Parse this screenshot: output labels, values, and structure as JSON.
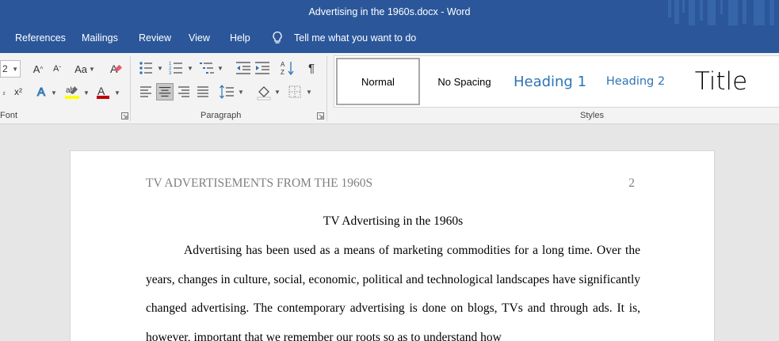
{
  "window": {
    "title": "Advertising in the 1960s.docx  -  Word"
  },
  "menu": {
    "tabs": [
      "References",
      "Mailings",
      "Review",
      "View",
      "Help"
    ],
    "tell_me": "Tell me what you want to do"
  },
  "ribbon": {
    "font_size": "2",
    "font_group_label": "Font",
    "paragraph_group_label": "Paragraph",
    "styles_group_label": "Styles",
    "pilcrow": "¶",
    "styles": [
      {
        "label": "Normal",
        "active": true
      },
      {
        "label": "No Spacing",
        "active": false
      },
      {
        "label": "Heading 1",
        "active": false
      },
      {
        "label": "Heading 2",
        "active": false
      },
      {
        "label": "Title",
        "active": false
      }
    ]
  },
  "document": {
    "running_head": "TV ADVERTISEMENTS FROM THE 1960S",
    "page_number": "2",
    "title": "TV Advertising in the 1960s",
    "paragraph": "Advertising has been used as a means of marketing commodities for a long time. Over the years, changes in culture, social, economic, political and technological landscapes have significantly changed advertising. The contemporary advertising is done on blogs, TVs and through ads. It is, however, important that we remember our roots so as to understand how"
  },
  "colors": {
    "accent": "#2b579a",
    "heading_style": "#2e74b5",
    "font_color": "#c00000",
    "highlight": "#ffff00"
  }
}
